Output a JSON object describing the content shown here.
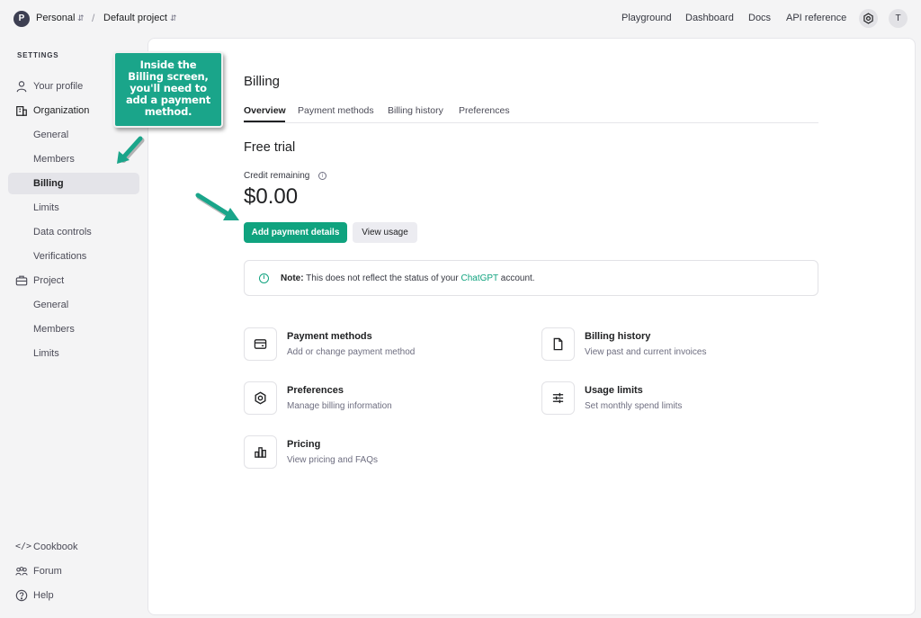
{
  "topbar": {
    "org_initial": "P",
    "org_name": "Personal",
    "separator": "/",
    "project_name": "Default project",
    "links": [
      "Playground",
      "Dashboard",
      "Docs",
      "API reference"
    ],
    "user_initial": "T"
  },
  "sidebar": {
    "heading": "SETTINGS",
    "items": [
      {
        "label": "Your profile",
        "icon": "person-icon"
      },
      {
        "label": "Organization",
        "icon": "building-icon"
      },
      {
        "label": "General"
      },
      {
        "label": "Members"
      },
      {
        "label": "Billing",
        "active": true
      },
      {
        "label": "Limits"
      },
      {
        "label": "Data controls"
      },
      {
        "label": "Verifications"
      },
      {
        "label": "Project",
        "icon": "briefcase-icon"
      },
      {
        "label": "General"
      },
      {
        "label": "Members"
      },
      {
        "label": "Limits"
      }
    ],
    "footer": [
      {
        "label": "Cookbook",
        "icon": "code-icon"
      },
      {
        "label": "Forum",
        "icon": "people-icon"
      },
      {
        "label": "Help",
        "icon": "help-icon"
      }
    ]
  },
  "main": {
    "title": "Billing",
    "tabs": [
      "Overview",
      "Payment methods",
      "Billing history",
      "Preferences"
    ],
    "section_title": "Free trial",
    "credit_label": "Credit remaining",
    "credit_amount": "$0.00",
    "primary_button": "Add payment details",
    "secondary_button": "View usage",
    "note": {
      "bold": "Note:",
      "text": "This does not reflect the status of your",
      "link": "ChatGPT",
      "suffix": "account."
    },
    "cards": [
      {
        "title": "Payment methods",
        "subtitle": "Add or change payment method",
        "icon": "credit-card-icon"
      },
      {
        "title": "Billing history",
        "subtitle": "View past and current invoices",
        "icon": "document-icon"
      },
      {
        "title": "Preferences",
        "subtitle": "Manage billing information",
        "icon": "gear-icon"
      },
      {
        "title": "Usage limits",
        "subtitle": "Set monthly spend limits",
        "icon": "sliders-icon"
      },
      {
        "title": "Pricing",
        "subtitle": "View pricing and FAQs",
        "icon": "bar-chart-icon"
      }
    ]
  },
  "annotation": {
    "lines": [
      "Inside the",
      "Billing screen,",
      "you'll need to",
      "add a payment",
      "method."
    ]
  },
  "colors": {
    "accent": "#10a37f",
    "callout": "#1aa58a",
    "background": "#f4f4f5"
  }
}
